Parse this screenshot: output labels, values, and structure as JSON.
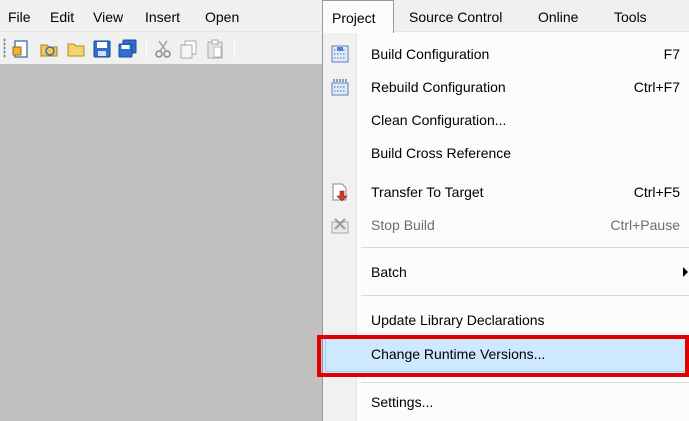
{
  "menubar": {
    "items": [
      {
        "label": "File"
      },
      {
        "label": "Edit"
      },
      {
        "label": "View"
      },
      {
        "label": "Insert"
      },
      {
        "label": "Open"
      },
      {
        "label": "Project"
      },
      {
        "label": "Source Control"
      },
      {
        "label": "Online"
      },
      {
        "label": "Tools"
      }
    ],
    "open_menu": "Project"
  },
  "toolbar": {
    "icons": [
      "new-icon",
      "open-folder-icon",
      "folder-icon",
      "save-icon",
      "save-all-icon",
      "cut-icon",
      "copy-icon",
      "paste-icon"
    ]
  },
  "project_menu": {
    "items": [
      {
        "label": "Build Configuration",
        "shortcut": "F7",
        "icon": "build-icon",
        "enabled": true
      },
      {
        "label": "Rebuild Configuration",
        "shortcut": "Ctrl+F7",
        "icon": "rebuild-icon",
        "enabled": true
      },
      {
        "label": "Clean Configuration...",
        "shortcut": "",
        "enabled": true
      },
      {
        "label": "Build Cross Reference",
        "shortcut": "",
        "enabled": true
      },
      {
        "label": "Transfer To Target",
        "shortcut": "Ctrl+F5",
        "icon": "transfer-icon",
        "enabled": true
      },
      {
        "label": "Stop Build",
        "shortcut": "Ctrl+Pause",
        "icon": "stop-build-icon",
        "enabled": false
      },
      {
        "label": "Batch",
        "has_submenu": true,
        "enabled": true
      },
      {
        "label": "Update Library Declarations",
        "enabled": true
      },
      {
        "label": "Change Runtime Versions...",
        "enabled": true,
        "highlighted": true
      },
      {
        "label": "Settings...",
        "enabled": true
      }
    ]
  },
  "colors": {
    "menubar_bg": "#f0f0f0",
    "workspace_bg": "#c0c0c0",
    "highlight": "#cde8ff",
    "annotation": "#e00000"
  }
}
